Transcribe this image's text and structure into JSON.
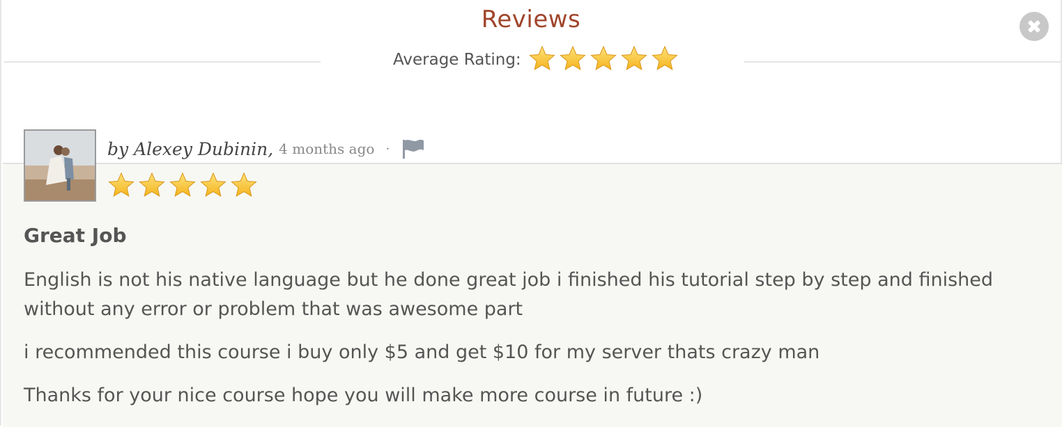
{
  "modal": {
    "title": "Reviews",
    "average_label": "Average Rating:",
    "average_rating": 5,
    "average_max": 5
  },
  "review": {
    "author_line": "by Alexey Dubinin,",
    "time_ago": "4 months ago",
    "separator": "·",
    "rating": 5,
    "rating_max": 5,
    "title": "Great Job",
    "paragraphs": [
      "English is not his native language but he done great job i finished his tutorial step by step and finished without any error or problem that was awesome part",
      "i recommended this course i buy only $5 and get $10 for my server thats crazy man",
      "Thanks for your nice course hope you will make more course in future :)"
    ]
  },
  "icons": {
    "close": "close-icon",
    "star": "star-icon",
    "flag": "flag-icon"
  },
  "colors": {
    "title": "#a0452b",
    "star_fill": "#f5b41e",
    "review_background": "#f7f8f3"
  }
}
